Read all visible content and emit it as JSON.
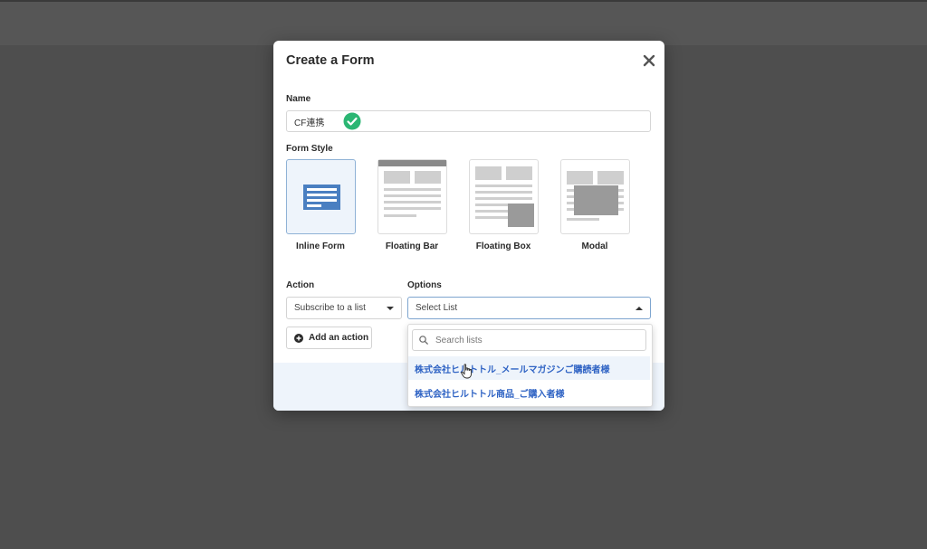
{
  "modal": {
    "title": "Create a Form",
    "name_label": "Name",
    "name_value": "CF連携",
    "form_style_label": "Form Style",
    "styles": [
      {
        "label": "Inline Form",
        "selected": true
      },
      {
        "label": "Floating Bar",
        "selected": false
      },
      {
        "label": "Floating Box",
        "selected": false
      },
      {
        "label": "Modal",
        "selected": false
      }
    ],
    "action_label": "Action",
    "action_value": "Subscribe to a list",
    "options_label": "Options",
    "options_value": "Select List",
    "add_action_label": "Add an action"
  },
  "dropdown": {
    "search_placeholder": "Search lists",
    "items": [
      {
        "label": "株式会社ヒルトトル_メールマガジンご購読者様"
      },
      {
        "label": "株式会社ヒルトトル商品_ご購入者様"
      }
    ]
  },
  "colors": {
    "accent_blue": "#2f63c4",
    "selected_bg": "#eef4fb",
    "check_green": "#2bb673",
    "inline_icon_blue": "#4a7fc1"
  }
}
